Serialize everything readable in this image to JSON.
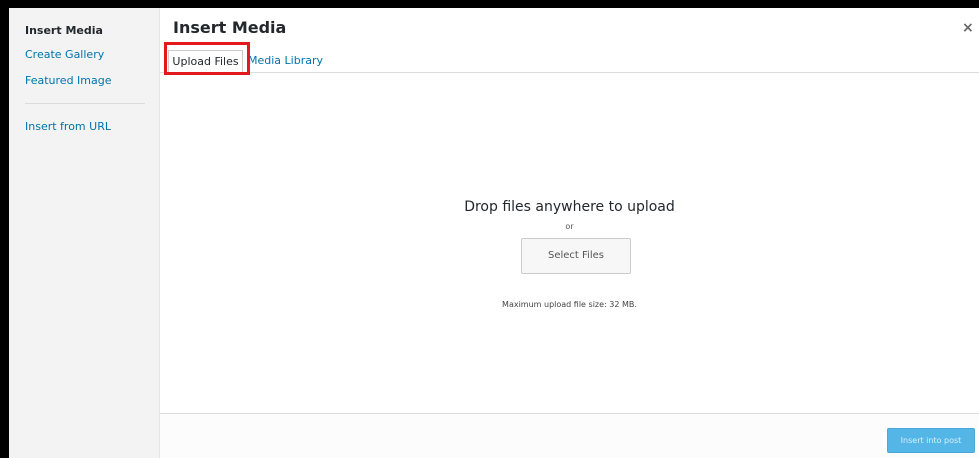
{
  "sidebar": {
    "items": [
      {
        "label": "Insert Media",
        "active": true
      },
      {
        "label": "Create Gallery",
        "active": false
      },
      {
        "label": "Featured Image",
        "active": false
      },
      {
        "label": "Insert from URL",
        "active": false
      }
    ]
  },
  "header": {
    "title": "Insert Media",
    "close_icon": "close-icon",
    "close_glyph": "×"
  },
  "tabs": [
    {
      "label": "Upload Files",
      "active": true
    },
    {
      "label": "Media Library",
      "active": false
    }
  ],
  "upload": {
    "drop_text": "Drop files anywhere to upload",
    "or_text": "or",
    "select_button": "Select Files",
    "max_size_text": "Maximum upload file size: 32 MB."
  },
  "toolbar": {
    "insert_button": "Insert into post"
  },
  "colors": {
    "link": "#0073aa",
    "highlight": "#e3191e",
    "primary_button": "#54b6e6",
    "sidebar_bg": "#f3f3f3"
  }
}
